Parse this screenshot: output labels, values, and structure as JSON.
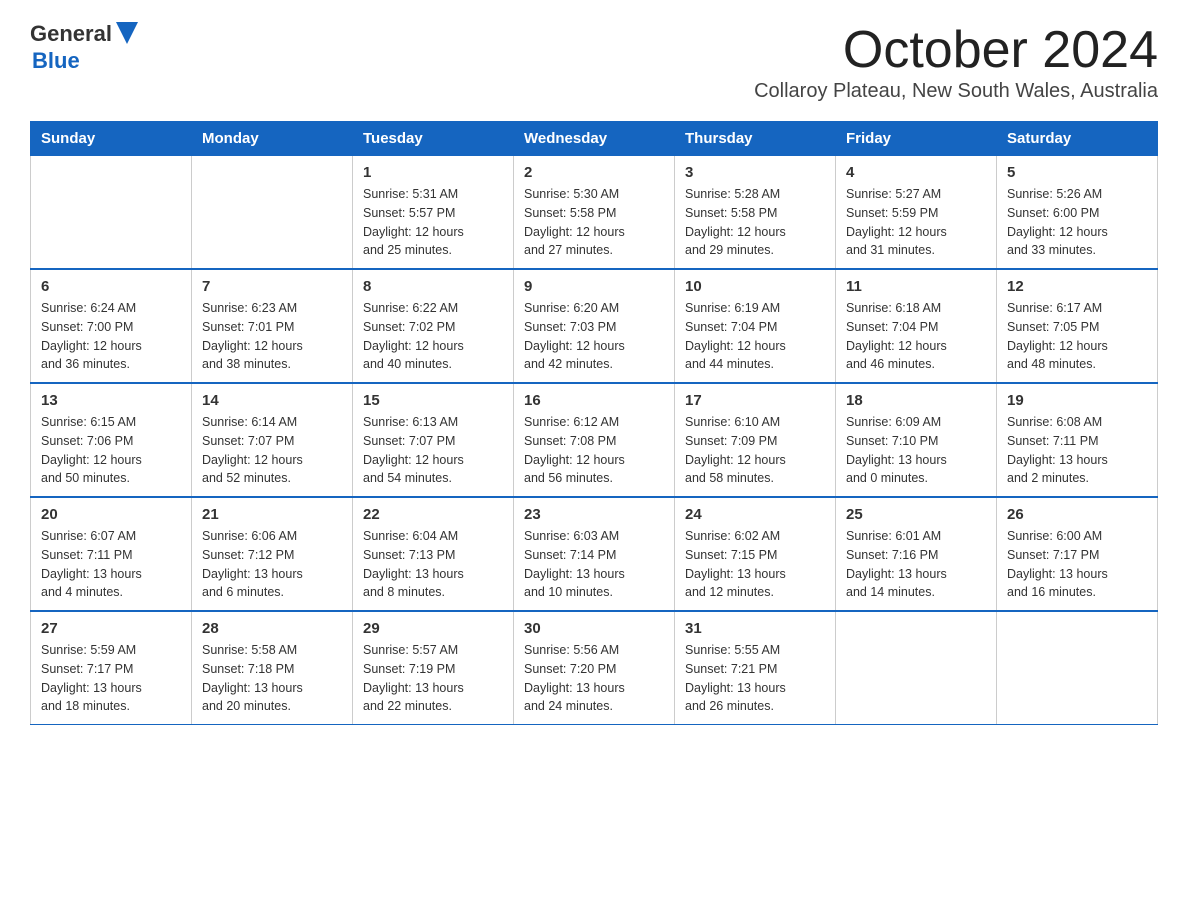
{
  "logo": {
    "text_general": "General",
    "text_blue": "Blue"
  },
  "title": "October 2024",
  "subtitle": "Collaroy Plateau, New South Wales, Australia",
  "days_of_week": [
    "Sunday",
    "Monday",
    "Tuesday",
    "Wednesday",
    "Thursday",
    "Friday",
    "Saturday"
  ],
  "weeks": [
    [
      {
        "day": "",
        "info": ""
      },
      {
        "day": "",
        "info": ""
      },
      {
        "day": "1",
        "info": "Sunrise: 5:31 AM\nSunset: 5:57 PM\nDaylight: 12 hours\nand 25 minutes."
      },
      {
        "day": "2",
        "info": "Sunrise: 5:30 AM\nSunset: 5:58 PM\nDaylight: 12 hours\nand 27 minutes."
      },
      {
        "day": "3",
        "info": "Sunrise: 5:28 AM\nSunset: 5:58 PM\nDaylight: 12 hours\nand 29 minutes."
      },
      {
        "day": "4",
        "info": "Sunrise: 5:27 AM\nSunset: 5:59 PM\nDaylight: 12 hours\nand 31 minutes."
      },
      {
        "day": "5",
        "info": "Sunrise: 5:26 AM\nSunset: 6:00 PM\nDaylight: 12 hours\nand 33 minutes."
      }
    ],
    [
      {
        "day": "6",
        "info": "Sunrise: 6:24 AM\nSunset: 7:00 PM\nDaylight: 12 hours\nand 36 minutes."
      },
      {
        "day": "7",
        "info": "Sunrise: 6:23 AM\nSunset: 7:01 PM\nDaylight: 12 hours\nand 38 minutes."
      },
      {
        "day": "8",
        "info": "Sunrise: 6:22 AM\nSunset: 7:02 PM\nDaylight: 12 hours\nand 40 minutes."
      },
      {
        "day": "9",
        "info": "Sunrise: 6:20 AM\nSunset: 7:03 PM\nDaylight: 12 hours\nand 42 minutes."
      },
      {
        "day": "10",
        "info": "Sunrise: 6:19 AM\nSunset: 7:04 PM\nDaylight: 12 hours\nand 44 minutes."
      },
      {
        "day": "11",
        "info": "Sunrise: 6:18 AM\nSunset: 7:04 PM\nDaylight: 12 hours\nand 46 minutes."
      },
      {
        "day": "12",
        "info": "Sunrise: 6:17 AM\nSunset: 7:05 PM\nDaylight: 12 hours\nand 48 minutes."
      }
    ],
    [
      {
        "day": "13",
        "info": "Sunrise: 6:15 AM\nSunset: 7:06 PM\nDaylight: 12 hours\nand 50 minutes."
      },
      {
        "day": "14",
        "info": "Sunrise: 6:14 AM\nSunset: 7:07 PM\nDaylight: 12 hours\nand 52 minutes."
      },
      {
        "day": "15",
        "info": "Sunrise: 6:13 AM\nSunset: 7:07 PM\nDaylight: 12 hours\nand 54 minutes."
      },
      {
        "day": "16",
        "info": "Sunrise: 6:12 AM\nSunset: 7:08 PM\nDaylight: 12 hours\nand 56 minutes."
      },
      {
        "day": "17",
        "info": "Sunrise: 6:10 AM\nSunset: 7:09 PM\nDaylight: 12 hours\nand 58 minutes."
      },
      {
        "day": "18",
        "info": "Sunrise: 6:09 AM\nSunset: 7:10 PM\nDaylight: 13 hours\nand 0 minutes."
      },
      {
        "day": "19",
        "info": "Sunrise: 6:08 AM\nSunset: 7:11 PM\nDaylight: 13 hours\nand 2 minutes."
      }
    ],
    [
      {
        "day": "20",
        "info": "Sunrise: 6:07 AM\nSunset: 7:11 PM\nDaylight: 13 hours\nand 4 minutes."
      },
      {
        "day": "21",
        "info": "Sunrise: 6:06 AM\nSunset: 7:12 PM\nDaylight: 13 hours\nand 6 minutes."
      },
      {
        "day": "22",
        "info": "Sunrise: 6:04 AM\nSunset: 7:13 PM\nDaylight: 13 hours\nand 8 minutes."
      },
      {
        "day": "23",
        "info": "Sunrise: 6:03 AM\nSunset: 7:14 PM\nDaylight: 13 hours\nand 10 minutes."
      },
      {
        "day": "24",
        "info": "Sunrise: 6:02 AM\nSunset: 7:15 PM\nDaylight: 13 hours\nand 12 minutes."
      },
      {
        "day": "25",
        "info": "Sunrise: 6:01 AM\nSunset: 7:16 PM\nDaylight: 13 hours\nand 14 minutes."
      },
      {
        "day": "26",
        "info": "Sunrise: 6:00 AM\nSunset: 7:17 PM\nDaylight: 13 hours\nand 16 minutes."
      }
    ],
    [
      {
        "day": "27",
        "info": "Sunrise: 5:59 AM\nSunset: 7:17 PM\nDaylight: 13 hours\nand 18 minutes."
      },
      {
        "day": "28",
        "info": "Sunrise: 5:58 AM\nSunset: 7:18 PM\nDaylight: 13 hours\nand 20 minutes."
      },
      {
        "day": "29",
        "info": "Sunrise: 5:57 AM\nSunset: 7:19 PM\nDaylight: 13 hours\nand 22 minutes."
      },
      {
        "day": "30",
        "info": "Sunrise: 5:56 AM\nSunset: 7:20 PM\nDaylight: 13 hours\nand 24 minutes."
      },
      {
        "day": "31",
        "info": "Sunrise: 5:55 AM\nSunset: 7:21 PM\nDaylight: 13 hours\nand 26 minutes."
      },
      {
        "day": "",
        "info": ""
      },
      {
        "day": "",
        "info": ""
      }
    ]
  ]
}
